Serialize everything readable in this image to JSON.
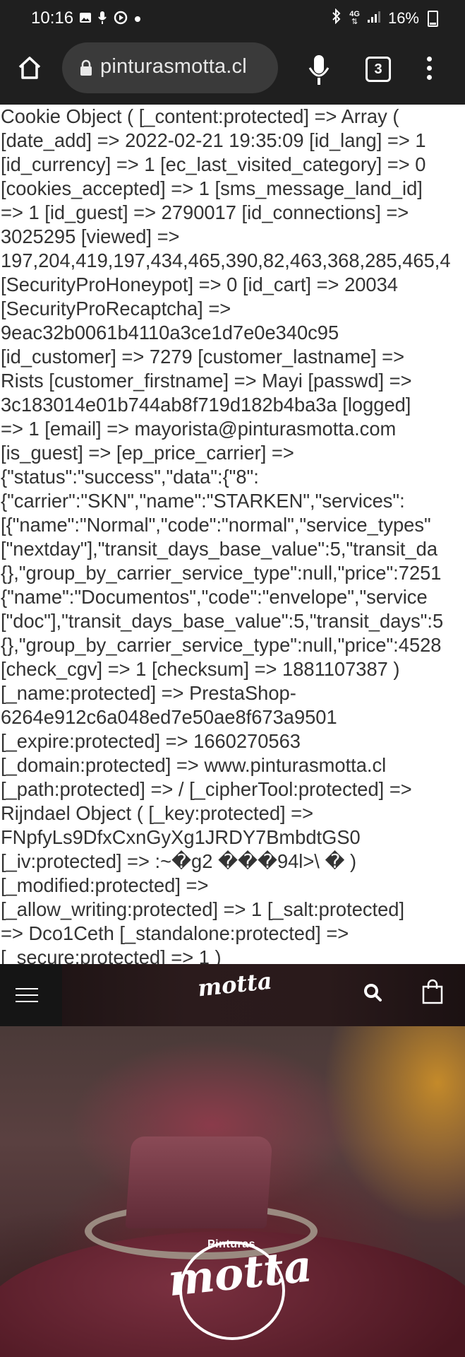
{
  "status_bar": {
    "time": "10:16",
    "signal_label": "4G",
    "battery": "16%",
    "left_icons": [
      "image-icon",
      "mic-small-icon",
      "sync-icon",
      "dot-icon"
    ],
    "right_icons": [
      "bluetooth-icon",
      "data-arrows-icon",
      "signal-bars-icon",
      "battery-icon"
    ]
  },
  "browser": {
    "url": "pinturasmotta.cl",
    "tab_count": "3",
    "icons": [
      "home-icon",
      "lock-icon",
      "mic-icon",
      "tabs-icon",
      "more-vert-icon"
    ]
  },
  "debug_lines": [
    "Cookie Object ( [_content:protected] => Array (",
    "[date_add] => 2022-02-21 19:35:09 [id_lang] => 1",
    "[id_currency] => 1 [ec_last_visited_category] => 0",
    "[cookies_accepted] => 1 [sms_message_land_id]",
    "=> 1 [id_guest] => 2790017 [id_connections] =>",
    "3025295 [viewed] =>",
    "197,204,419,197,434,465,390,82,463,368,285,465,4",
    "[SecurityProHoneypot] => 0 [id_cart] => 20034",
    "[SecurityProRecaptcha] =>",
    "9eac32b0061b4110a3ce1d7e0e340c95",
    "[id_customer] => 7279 [customer_lastname] =>",
    "Rists [customer_firstname] => Mayi [passwd] =>",
    "3c183014e01b744ab8f719d182b4ba3a [logged]",
    "=> 1 [email] => mayorista@pinturasmotta.com",
    "[is_guest] => [ep_price_carrier] =>",
    "{\"status\":\"success\",\"data\":{\"8\":",
    "{\"carrier\":\"SKN\",\"name\":\"STARKEN\",\"services\":",
    "[{\"name\":\"Normal\",\"code\":\"normal\",\"service_types\"",
    "[\"nextday\"],\"transit_days_base_value\":5,\"transit_da",
    "{},\"group_by_carrier_service_type\":null,\"price\":7251",
    "{\"name\":\"Documentos\",\"code\":\"envelope\",\"service",
    "[\"doc\"],\"transit_days_base_value\":5,\"transit_days\":5",
    "{},\"group_by_carrier_service_type\":null,\"price\":4528",
    "[check_cgv] => 1 [checksum] => 1881107387 )",
    "[_name:protected] => PrestaShop-",
    "6264e912c6a048ed7e50ae8f673a9501",
    "[_expire:protected] => 1660270563",
    "[_domain:protected] => www.pinturasmotta.cl",
    "[_path:protected] => / [_cipherTool:protected] =>",
    "Rijndael Object ( [_key:protected] =>",
    "FNpfyLs9DfxCxnGyXg1JRDY7BmbdtGS0",
    "[_iv:protected] => :~�g2 ���94l>\\ � )",
    "[_modified:protected] =>",
    "[_allow_writing:protected] => 1 [_salt:protected]",
    "=> Dco1Ceth [_standalone:protected] =>",
    "[_secure:protected] => 1 )"
  ],
  "site_header": {
    "logo": "motta",
    "icons": [
      "hamburger-menu-icon",
      "search-icon",
      "shopping-bag-icon"
    ]
  },
  "hero": {
    "badge_top": "Pinturas",
    "badge_main": "motta"
  }
}
